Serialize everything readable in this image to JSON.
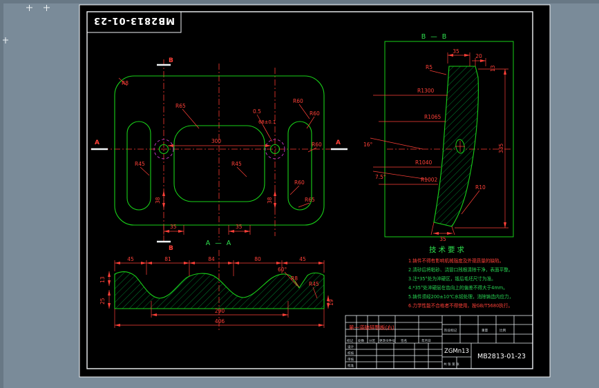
{
  "window": {
    "background": "#7a8b99",
    "sheet_color": "#000000",
    "colors": {
      "geometry": "#19d219",
      "dimension": "#ff4038",
      "frame": "#f2f5f7",
      "centerline": "#ff3a30",
      "phantom": "#e040e0",
      "hatch": "#00a33a"
    }
  },
  "title_strip": {
    "text": "MB2813-01-23"
  },
  "plan_view": {
    "section_marks": {
      "a_left": "A",
      "a_right": "A",
      "b_top": "B",
      "b_bottom": "B"
    },
    "dims": {
      "r8_top": "R8",
      "r65_top": "R65",
      "c05": "0.5",
      "d68": "68±0.1",
      "r60_a": "R60",
      "r60_b": "R60",
      "r60_c": "R60",
      "r60_d": "R60",
      "r65_b": "R65",
      "r45_left": "R45",
      "r45_center": "R45",
      "d300": "300",
      "d38_left": "38",
      "d38_right": "38",
      "d35_left": "35",
      "d35_right": "35"
    }
  },
  "section_bb": {
    "title": "B — B",
    "dims": {
      "d35_top": "35",
      "d20": "20",
      "r5": "R5",
      "d13": "13",
      "r1300": "R1300",
      "r1065": "R1065",
      "r1040": "R1040",
      "r1002": "R1002",
      "a16": "16°",
      "a75": "7.5°",
      "d335": "335",
      "r10": "R10",
      "d35_bottom": "35"
    }
  },
  "section_aa": {
    "title": "A — A",
    "top_dims": [
      "45",
      "81",
      "84",
      "80",
      "45"
    ],
    "dims": {
      "a60": "60°",
      "r8": "R8",
      "r45": "R45",
      "d13": "13",
      "d25": "25",
      "d19": "19",
      "d290": "290",
      "d406": "406"
    }
  },
  "tech_requirements": {
    "heading": "技术要求",
    "lines": [
      "1.铸件不得有影响机械强度及外观质量的缺陷。",
      "2.清砂后将粘砂、浇冒口残根清除干净，表面平整。",
      "3.注*35°处为淬硬区，锻后毛坯尺寸为准。",
      "4.*35°处淬硬层在齿向上的偏差不得大于4mm。",
      "5.铸件须经200±10℃水韧处理，消除铸造内应力，",
      "6.力学性能不合格者不得使用，按GB/T5680执行。"
    ]
  },
  "title_block": {
    "part_name": "第一道破碎颚板(右)",
    "material": "ZGMn13",
    "drawing_no": "MB2813-01-23",
    "labels": {
      "stage": "阶段标记",
      "weight": "重量",
      "scale": "比例",
      "sheets": "共 张 第 张",
      "mark": "标记",
      "count": "处数",
      "zone": "分区",
      "doc_no": "更改文件号",
      "sign": "签名",
      "date": "年月日",
      "design": "设计",
      "check": "校核",
      "audit": "审核",
      "approve": "批准"
    }
  }
}
